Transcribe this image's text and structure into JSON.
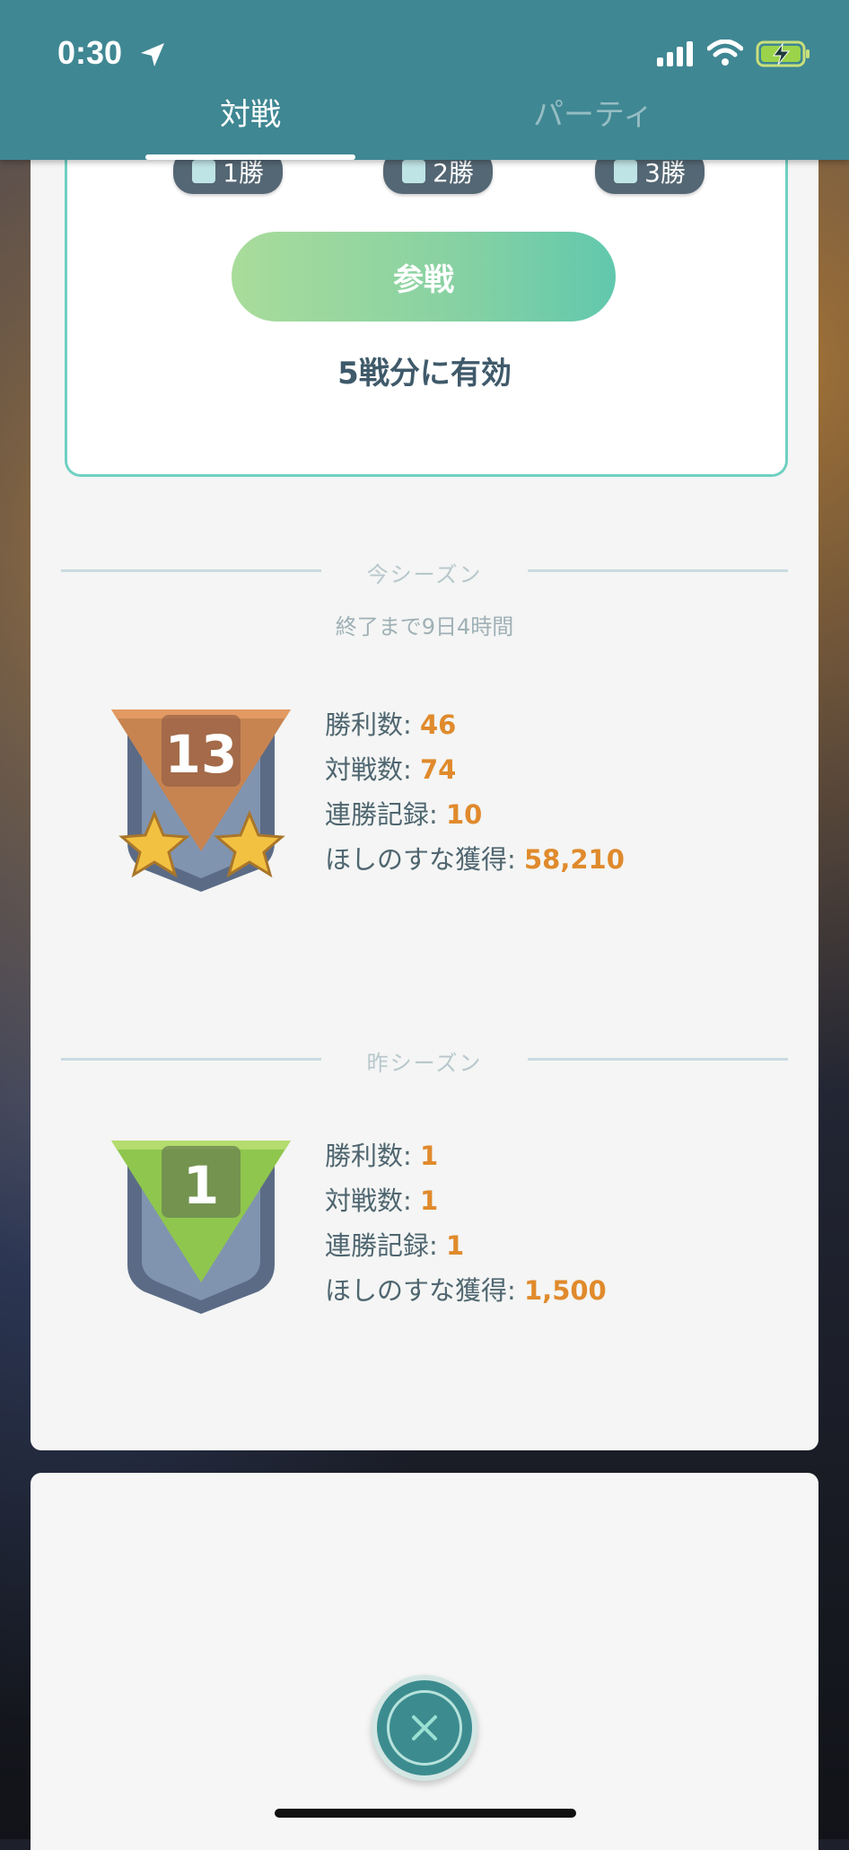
{
  "status_bar": {
    "time": "0:30"
  },
  "tabs": [
    {
      "label": "対戦",
      "active": true
    },
    {
      "label": "パーティ",
      "active": false
    }
  ],
  "entry": {
    "wins": [
      "1勝",
      "2勝",
      "3勝"
    ],
    "join_label": "参戦",
    "valid_text": "5戦分に有効"
  },
  "current_season": {
    "title": "今シーズン",
    "countdown": "終了まで9日4時間",
    "rank": "13",
    "stars": 2,
    "stats": [
      {
        "label": "勝利数: ",
        "value": "46"
      },
      {
        "label": "対戦数: ",
        "value": "74"
      },
      {
        "label": "連勝記録: ",
        "value": "10"
      },
      {
        "label": "ほしのすな獲得: ",
        "value": "58,210"
      }
    ]
  },
  "previous_season": {
    "title": "昨シーズン",
    "rank": "1",
    "stats": [
      {
        "label": "勝利数: ",
        "value": "1"
      },
      {
        "label": "対戦数: ",
        "value": "1"
      },
      {
        "label": "連勝記録: ",
        "value": "1"
      },
      {
        "label": "ほしのすな獲得: ",
        "value": "1,500"
      }
    ]
  },
  "icons": {
    "location": "location-arrow-icon",
    "signal": "signal-icon",
    "wifi": "wifi-icon",
    "battery": "battery-charging-icon",
    "close": "close-icon"
  },
  "colors": {
    "header": "#3f8793",
    "accent_value": "#e08a2c",
    "join_gradient_start": "#a9dc9b",
    "join_gradient_end": "#61c8ad"
  }
}
